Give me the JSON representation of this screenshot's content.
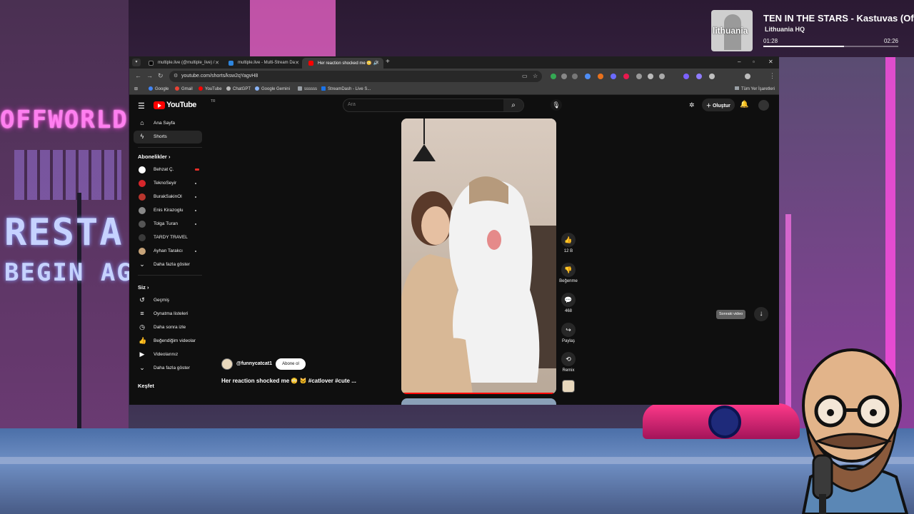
{
  "scene": {
    "signs": {
      "offworld": "OFFWORLD",
      "restaurant": "RESTA",
      "begin": "BEGIN AG"
    }
  },
  "now_playing": {
    "title": "TEN IN THE STARS - Kastuvas (Of",
    "artist": "Lithuania HQ",
    "album_label": "lithuania",
    "elapsed": "01:28",
    "total": "02:26",
    "progress": 0.6
  },
  "browser": {
    "tabs": [
      {
        "label": "multiple.live (@multiple_live) /",
        "favicon": "x-icon"
      },
      {
        "label": "multiple.live - Multi-Stream Da",
        "favicon": "multiple-icon"
      },
      {
        "label": "Her reaction shocked me 😳 🔊",
        "favicon": "youtube-icon",
        "active": true
      }
    ],
    "new_tab": "+",
    "window_controls": {
      "minimize": "–",
      "maximize": "▫",
      "close": "✕"
    },
    "url": "youtube.com/shorts/ksw2qYagvH8",
    "bookmarks": [
      {
        "label": "Google",
        "color": "#4285f4"
      },
      {
        "label": "Gmail",
        "color": "#ea4335"
      },
      {
        "label": "YouTube",
        "color": "#ff0000"
      },
      {
        "label": "ChatGPT",
        "color": "#bbbbbb"
      },
      {
        "label": "Google Gemini",
        "color": "#8ab4f8"
      },
      {
        "label": "ssssss",
        "color": "#9aa0a6"
      },
      {
        "label": "StreamDash - Live S...",
        "color": "#1a73e8"
      }
    ],
    "all_bookmarks": "Tüm Yer İşaretleri"
  },
  "youtube": {
    "logo": "YouTube",
    "country": "TR",
    "search_placeholder": "Ara",
    "create_label": "Oluştur",
    "nav": [
      {
        "label": "Ana Sayfa",
        "icon": "home-icon"
      },
      {
        "label": "Shorts",
        "icon": "shorts-icon",
        "active": true
      }
    ],
    "subscriptions_heading": "Abonelikler",
    "subscriptions": [
      {
        "label": "Behzat Ç.",
        "color": "#ffffff",
        "live": true
      },
      {
        "label": "TeknoSeyir",
        "color": "#d6262b"
      },
      {
        "label": "BurakSakinOl",
        "color": "#b8352d"
      },
      {
        "label": "Enis Kirazoglu",
        "color": "#888888"
      },
      {
        "label": "Tolga Turan",
        "color": "#555555"
      },
      {
        "label": "TARDY TRAVEL",
        "color": "#3a3a3a"
      },
      {
        "label": "Ayhan Tarakcı",
        "color": "#c7a47a"
      }
    ],
    "show_more": "Daha fazla göster",
    "you_heading": "Siz",
    "you_items": [
      {
        "label": "Geçmiş",
        "icon": "history-icon"
      },
      {
        "label": "Oynatma listeleri",
        "icon": "playlists-icon"
      },
      {
        "label": "Daha sonra izle",
        "icon": "watch-later-icon"
      },
      {
        "label": "Beğendiğim videolar",
        "icon": "liked-videos-icon"
      },
      {
        "label": "Videolarınız",
        "icon": "your-videos-icon"
      },
      {
        "label": "Daha fazla göster",
        "icon": "chevron-down-icon"
      }
    ],
    "explore_heading": "Keşfet",
    "short": {
      "channel": "@funnycatcat1",
      "subscribe": "Abone ol",
      "title": "Her reaction shocked me 😳 🐱 #catlover #cute ...",
      "progress": 0.98,
      "actions": [
        {
          "icon": "like-icon",
          "label": "12 B"
        },
        {
          "icon": "dislike-icon",
          "label": "Beğenme"
        },
        {
          "icon": "comment-icon",
          "label": "468"
        },
        {
          "icon": "share-icon",
          "label": "Paylaş"
        },
        {
          "icon": "remix-icon",
          "label": "Remix"
        }
      ]
    },
    "next_tooltip": "Sonraki video"
  }
}
